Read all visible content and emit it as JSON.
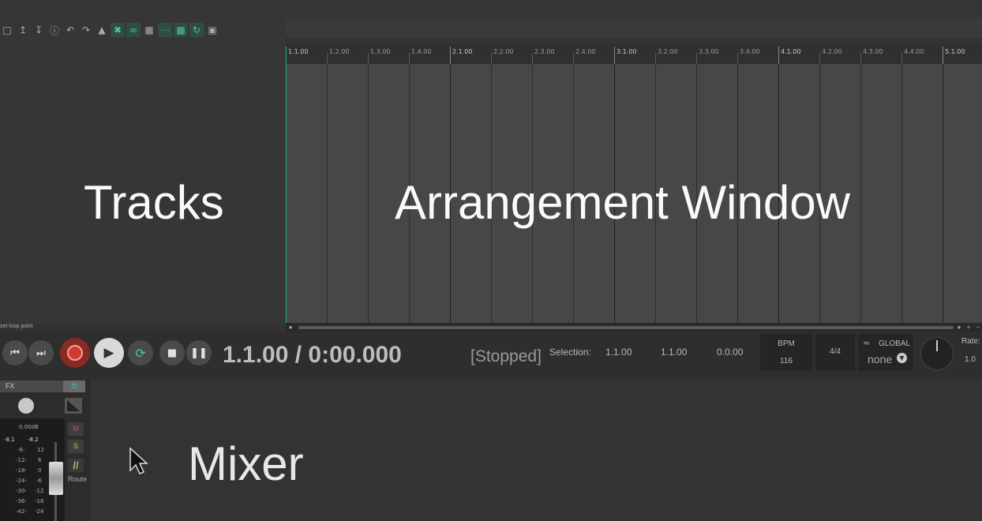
{
  "overlay": {
    "tracks": "Tracks",
    "arrangement": "Arrangement Window",
    "mixer": "Mixer"
  },
  "ruler": {
    "labels": [
      "1.1.00",
      "1.2.00",
      "1.3.00",
      "1.4.00",
      "2.1.00",
      "2.2.00",
      "2.3.00",
      "2.4.00",
      "3.1.00",
      "3.2.00",
      "3.3.00",
      "3.4.00",
      "4.1.00",
      "4.2.00",
      "4.3.00",
      "4.4.00",
      "5.1.00"
    ]
  },
  "toolbar": {
    "icons": [
      "new-icon",
      "upload-icon",
      "download-icon",
      "info-icon",
      "undo-icon",
      "redo-icon",
      "metronome-icon",
      "ripple-edit-icon",
      "link-icon",
      "grid-icon",
      "snap-icon",
      "grid-lines-icon",
      "loop-icon",
      "lock-icon"
    ]
  },
  "transport": {
    "loop_label": "set loop point",
    "time": "1.1.00 / 0:00.000",
    "status": "[Stopped]",
    "selection_label": "Selection:",
    "selection_start": "1.1.00",
    "selection_end": "1.1.00",
    "selection_length": "0.0.00",
    "bpm_label": "BPM",
    "bpm_value": "116",
    "time_signature": "4/4",
    "global_label": "GLOBAL",
    "global_value": "none",
    "rate_label": "Rate:",
    "rate_value": "1.0"
  },
  "mixer": {
    "fx_label": "FX",
    "gain": "0.00dB",
    "peak_left": "-8.1",
    "peak_right": "-8.2",
    "scale": [
      "-6-",
      "-12-",
      "-18-",
      "-24-",
      "-30-",
      "-36-",
      "-42-"
    ],
    "scale_right": [
      "12",
      "6",
      "0",
      "-6",
      "-12",
      "-18",
      "-24"
    ],
    "mute": "M",
    "solo": "S",
    "route": "Route"
  },
  "colors": {
    "accent": "#2bb07b",
    "record": "#d1392f",
    "background": "#333333"
  }
}
